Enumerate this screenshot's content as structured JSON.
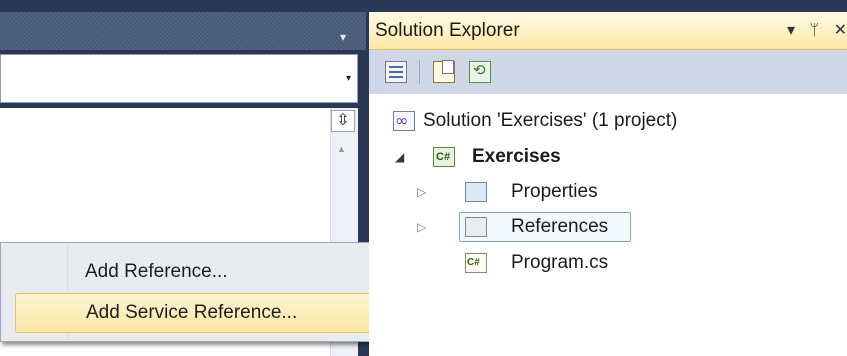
{
  "editor": {
    "dropdown_arrow": "▾",
    "combo_arrow": "▾",
    "splitter_glyph": "⇳",
    "scroll_up_glyph": "▲"
  },
  "context_menu": {
    "items": [
      {
        "label": "Add Reference..."
      },
      {
        "label": "Add Service Reference...",
        "highlighted": true
      }
    ]
  },
  "solution_explorer": {
    "title": "Solution Explorer",
    "pane_buttons": {
      "dropdown": "▾",
      "pin": "ᛘ",
      "close": "✕"
    },
    "toolbar": [
      {
        "icon": "properties-icon"
      },
      {
        "icon": "show-all-files-icon"
      },
      {
        "icon": "refresh-icon"
      }
    ],
    "tree": {
      "solution": "Solution 'Exercises' (1 project)",
      "project": {
        "label": "Exercises",
        "expander": "◢"
      },
      "children": [
        {
          "label": "Properties",
          "expander": "▷",
          "icon": "properties-folder-icon"
        },
        {
          "label": "References",
          "expander": "▷",
          "icon": "references-folder-icon",
          "selected": true
        },
        {
          "label": "Program.cs",
          "icon": "csharp-file-icon"
        }
      ]
    }
  },
  "colors": {
    "background": "#293955",
    "menu_highlight": "#fbe6a4",
    "titlebar_active": "#ffe8a6"
  }
}
